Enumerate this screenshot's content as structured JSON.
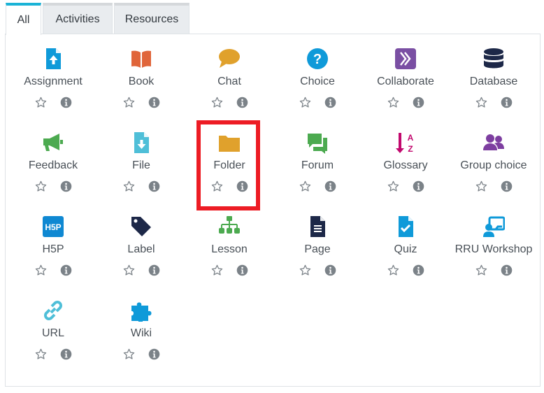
{
  "tabs": [
    {
      "label": "All",
      "active": true
    },
    {
      "label": "Activities",
      "active": false
    },
    {
      "label": "Resources",
      "active": false
    }
  ],
  "items": [
    {
      "label": "Assignment",
      "icon": "assignment-icon",
      "color": "#0f9ad9"
    },
    {
      "label": "Book",
      "icon": "book-icon",
      "color": "#e0653a"
    },
    {
      "label": "Chat",
      "icon": "chat-icon",
      "color": "#e0a12c"
    },
    {
      "label": "Choice",
      "icon": "choice-icon",
      "color": "#0f9ad9"
    },
    {
      "label": "Collaborate",
      "icon": "collaborate-icon",
      "color": "#7a4fa3"
    },
    {
      "label": "Database",
      "icon": "database-icon",
      "color": "#1d2848"
    },
    {
      "label": "Feedback",
      "icon": "feedback-icon",
      "color": "#4caa50"
    },
    {
      "label": "File",
      "icon": "file-icon",
      "color": "#4fbfd8"
    },
    {
      "label": "Folder",
      "icon": "folder-icon",
      "color": "#e0a12c"
    },
    {
      "label": "Forum",
      "icon": "forum-icon",
      "color": "#4caa50"
    },
    {
      "label": "Glossary",
      "icon": "glossary-icon",
      "color": "#c2096e"
    },
    {
      "label": "Group choice",
      "icon": "group-choice-icon",
      "color": "#7d3ea0"
    },
    {
      "label": "H5P",
      "icon": "h5p-icon",
      "color": "#0f88d2"
    },
    {
      "label": "Label",
      "icon": "label-icon",
      "color": "#1d2848"
    },
    {
      "label": "Lesson",
      "icon": "lesson-icon",
      "color": "#4caa50"
    },
    {
      "label": "Page",
      "icon": "page-icon",
      "color": "#1d2848"
    },
    {
      "label": "Quiz",
      "icon": "quiz-icon",
      "color": "#0f9ad9"
    },
    {
      "label": "RRU Workshop",
      "icon": "workshop-icon",
      "color": "#0f9ad9"
    },
    {
      "label": "URL",
      "icon": "url-icon",
      "color": "#4fbfd8"
    },
    {
      "label": "Wiki",
      "icon": "wiki-icon",
      "color": "#0f9ad9"
    }
  ],
  "highlighted_item": "Folder",
  "colors": {
    "tab_accent": "#1ab3d6",
    "highlight": "#ed1c24",
    "action_icon": "#7b8288"
  }
}
